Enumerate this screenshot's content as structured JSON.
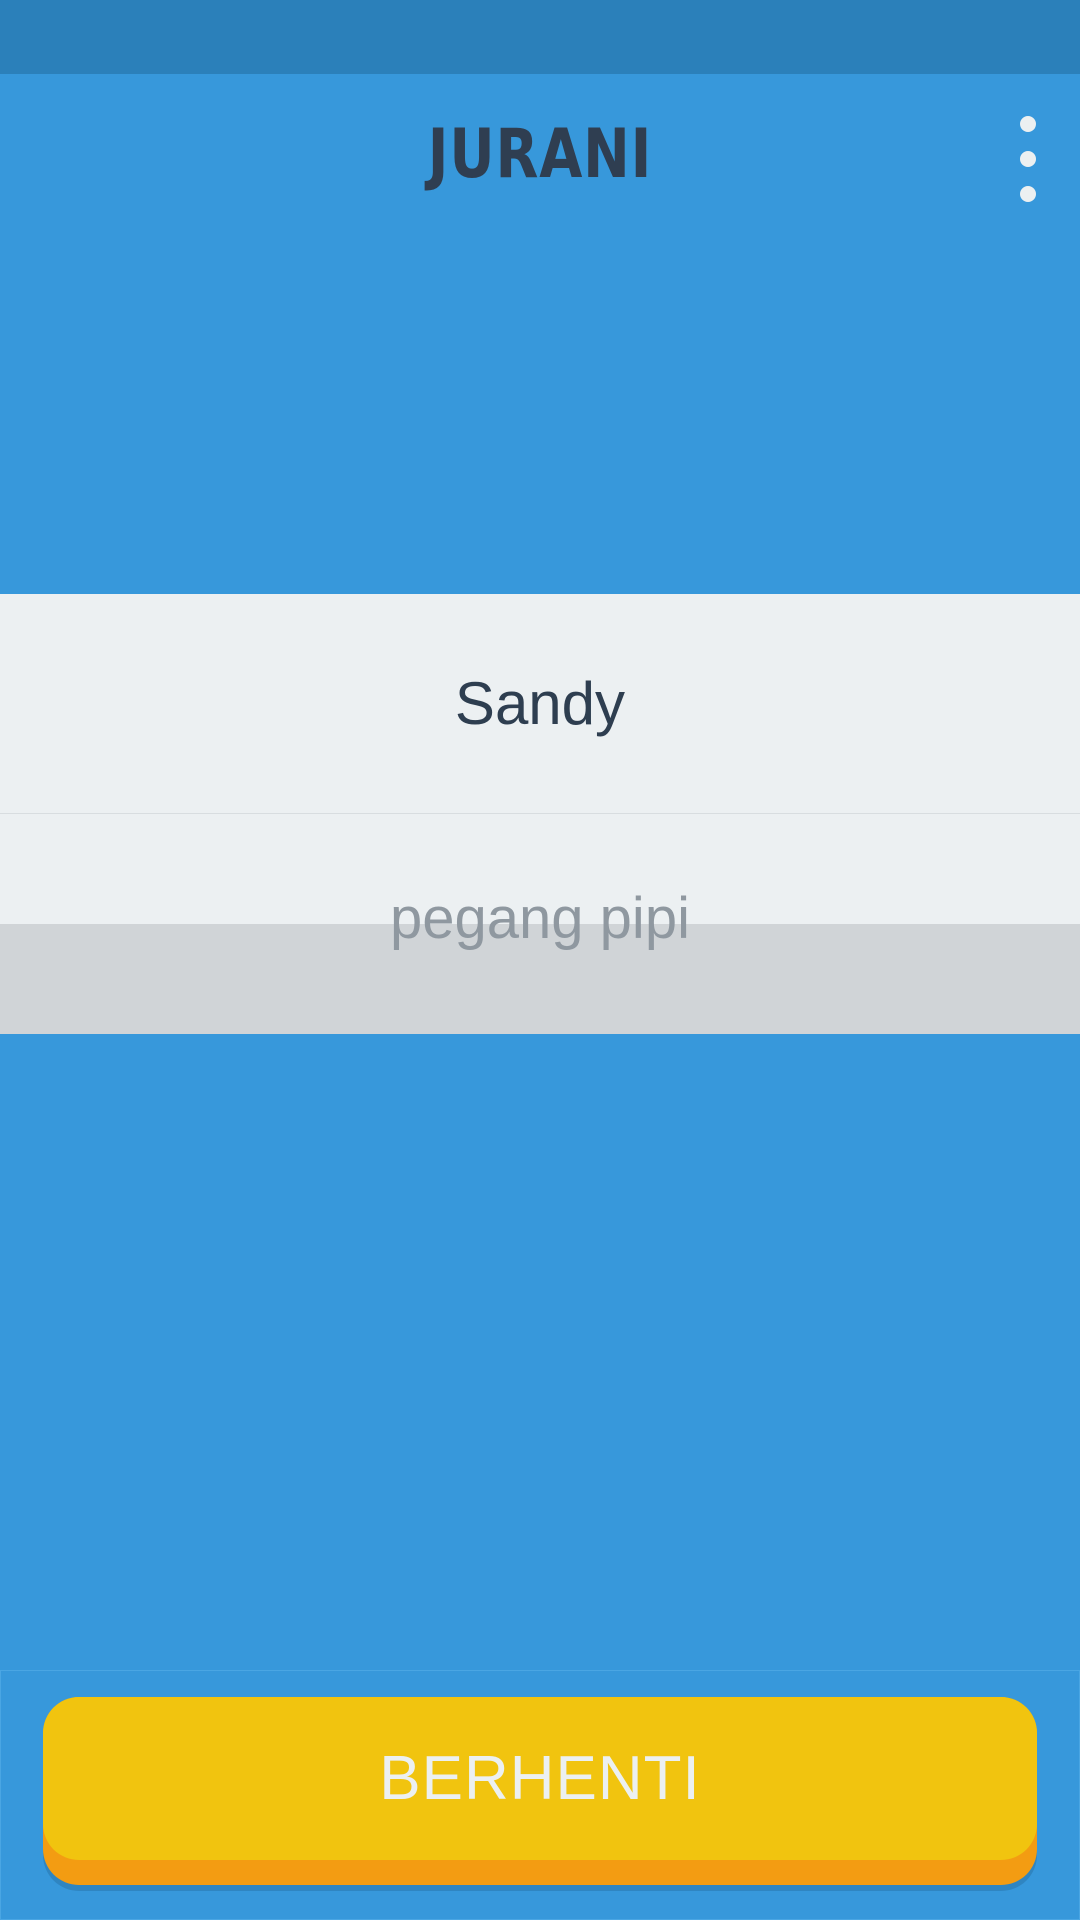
{
  "app": {
    "logo_text": "JURANI",
    "menu_icon": "overflow-menu-icon"
  },
  "game": {
    "player_name": "Sandy",
    "action_text": "pegang pipi"
  },
  "controls": {
    "stop_label": "BERHENTI"
  },
  "colors": {
    "background": "#3798db",
    "status_bar": "#2b80ba",
    "panel": "#ecf0f2",
    "text_dark": "#2e3e50",
    "button_yellow": "#f1c40f",
    "button_orange": "#f39c12"
  }
}
